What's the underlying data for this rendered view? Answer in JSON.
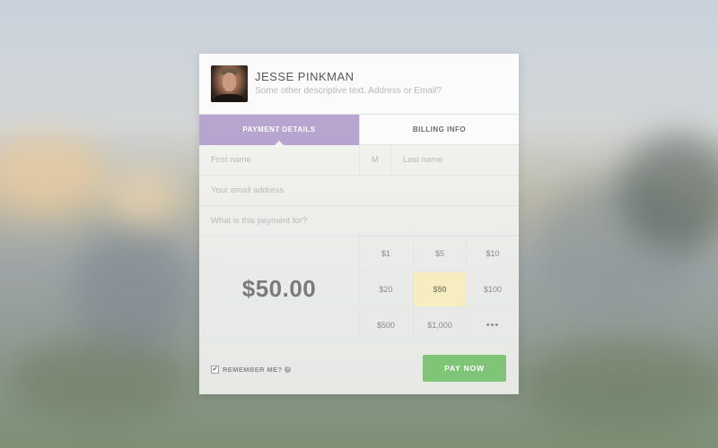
{
  "user": {
    "name": "JESSE PINKMAN",
    "description": "Some other descriptive text. Address or Email?"
  },
  "tabs": [
    {
      "label": "PAYMENT DETAILS",
      "active": true
    },
    {
      "label": "BILLING INFO",
      "active": false
    }
  ],
  "form": {
    "first_name_placeholder": "First name",
    "middle_initial_placeholder": "M",
    "last_name_placeholder": "Last name",
    "email_placeholder": "Your email address",
    "purpose_placeholder": "What is this payment for?"
  },
  "amount": {
    "display": "$50.00",
    "presets": [
      "$1",
      "$5",
      "$10",
      "$20",
      "$50",
      "$100",
      "$500",
      "$1,000",
      "•••"
    ],
    "selected": "$50"
  },
  "footer": {
    "remember_label": "REMEMBER ME?",
    "remember_checked": true,
    "checkbox_mark": "✔",
    "info_icon": "i",
    "pay_label": "PAY NOW"
  },
  "colors": {
    "tab_active": "#b7a4cf",
    "pay_button": "#7fc477",
    "selected_preset": "#f6eec0"
  }
}
